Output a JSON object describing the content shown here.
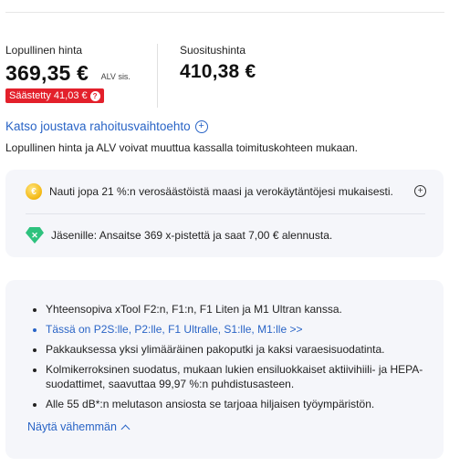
{
  "price": {
    "final_label": "Lopullinen hinta",
    "final_value": "369,35 €",
    "vat_note": "ALV sis.",
    "saved_badge": "Säästetty 41,03 €",
    "saved_info_icon": "?",
    "recommended_label": "Suositushinta",
    "recommended_value": "410,38 €"
  },
  "financing": {
    "link_label": "Katso joustava rahoitusvaihtoehto",
    "icon": "plus-circle-icon"
  },
  "vat_disclaimer": "Lopullinen hinta ja ALV voivat muuttua kassalla toimituskohteen mukaan.",
  "benefits": {
    "tax_text": "Nauti jopa 21 %:n verosäästöistä maasi ja verokäytäntöjesi mukaisesti.",
    "tax_icon": "coin-icon",
    "member_text": "Jäsenille: Ansaitse 369 x-pistettä ja saat 7,00 € alennusta.",
    "member_icon": "gem-icon"
  },
  "features": {
    "items": [
      "Yhteensopiva xTool F2:n, F1:n, F1 Liten ja M1 Ultran kanssa.",
      "Tässä on P2S:lle, P2:lle, F1 Ultralle, S1:lle, M1:lle >>",
      "Pakkauksessa yksi ylimääräinen pakoputki ja kaksi varaesisuodatinta.",
      "Kolmikerroksinen suodatus, mukaan lukien ensiluokkaiset aktiivihiili- ja HEPA-suodattimet, saavuttaa 99,97 %:n puhdistusasteen.",
      "Alle 55 dB*:n melutason ansiosta se tarjoaa hiljaisen työympäristön."
    ],
    "show_less": "Näytä vähemmän"
  },
  "colors": {
    "accent": "#2964c6",
    "badge_red": "#e3202b",
    "card_bg": "#f5f6fa"
  }
}
